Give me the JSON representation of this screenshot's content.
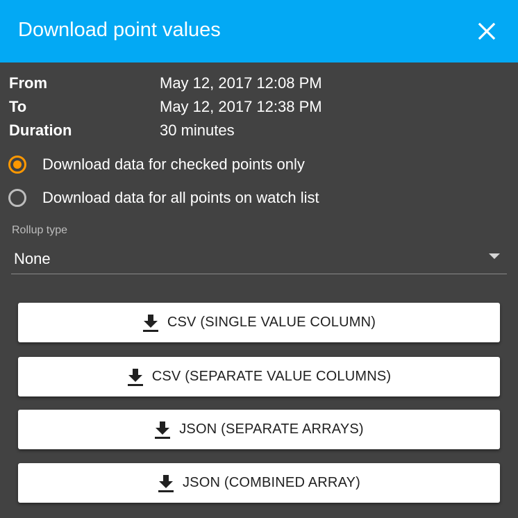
{
  "dialog": {
    "title": "Download point values",
    "close_icon": "close-icon"
  },
  "info": [
    {
      "label": "From",
      "value": "May 12, 2017 12:08 PM"
    },
    {
      "label": "To",
      "value": "May 12, 2017 12:38 PM"
    },
    {
      "label": "Duration",
      "value": "30 minutes"
    }
  ],
  "options": [
    {
      "label": "Download data for checked points only",
      "checked": true
    },
    {
      "label": "Download data for all points on watch list",
      "checked": false
    }
  ],
  "rollup": {
    "caption": "Rollup type",
    "value": "None"
  },
  "buttons": [
    {
      "label": "CSV (SINGLE VALUE COLUMN)",
      "icon": "download-icon"
    },
    {
      "label": "CSV (SEPARATE VALUE COLUMNS)",
      "icon": "download-icon"
    },
    {
      "label": "JSON (SEPARATE ARRAYS)",
      "icon": "download-icon"
    },
    {
      "label": "JSON (COMBINED ARRAY)",
      "icon": "download-icon"
    }
  ],
  "colors": {
    "titlebar": "#03a9f4",
    "background": "#424242",
    "accent": "#ff9800"
  }
}
